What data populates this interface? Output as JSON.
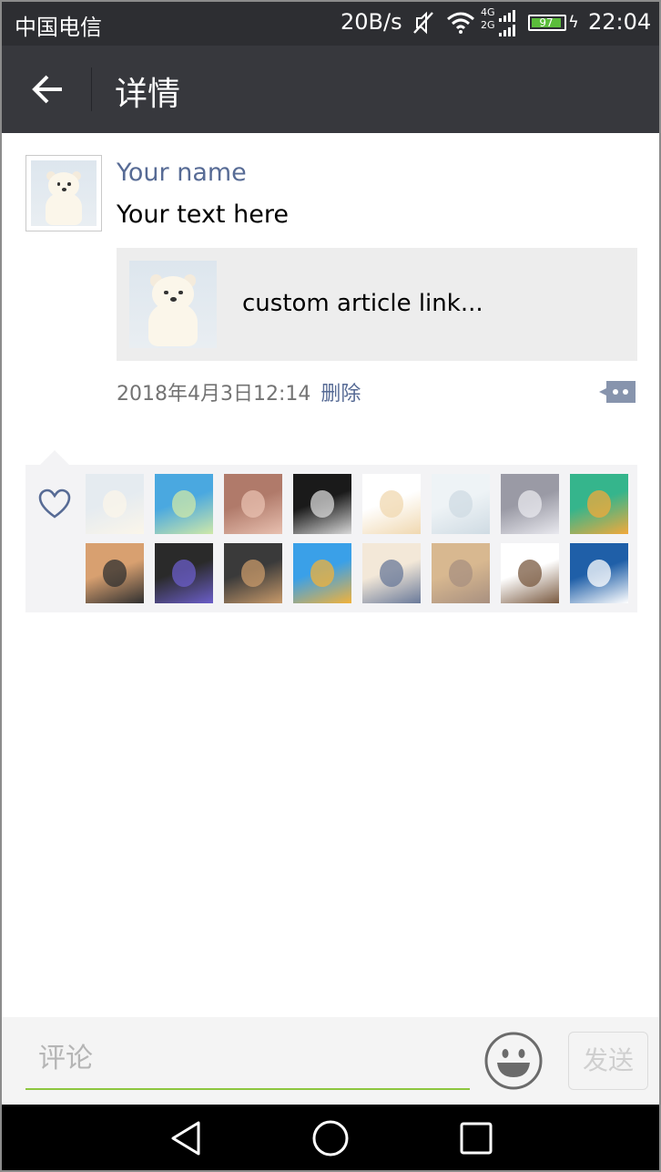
{
  "status_bar": {
    "carrier": "中国电信",
    "speed": "20B/s",
    "network_top": "4G",
    "network_bottom": "2G",
    "battery": "97",
    "time": "22:04"
  },
  "header": {
    "title": "详情"
  },
  "post": {
    "name": "Your name",
    "text": "Your text here",
    "article_title": "custom article link...",
    "date": "2018年4月3日12:14",
    "delete_label": "删除"
  },
  "likes": {
    "avatars": [
      {
        "icon": "bear-avatar",
        "colors": [
          "#e5ebf0",
          "#fbf6ea"
        ]
      },
      {
        "icon": "anime-boy-avatar",
        "colors": [
          "#4aa8e0",
          "#cfe8a8"
        ]
      },
      {
        "icon": "girl-glasses-avatar",
        "colors": [
          "#b07a6a",
          "#e8c0b0"
        ]
      },
      {
        "icon": "dark-face-avatar",
        "colors": [
          "#1a1a1a",
          "#d8d8d8"
        ]
      },
      {
        "icon": "cartoon-cat-avatar",
        "colors": [
          "#ffffff",
          "#f0d8b0"
        ]
      },
      {
        "icon": "mountain-placeholder-avatar",
        "colors": [
          "#eef3f6",
          "#cfdbe3"
        ]
      },
      {
        "icon": "sleeping-cat-avatar",
        "colors": [
          "#9a9aa5",
          "#e8e8ee"
        ]
      },
      {
        "icon": "daima-app-avatar",
        "colors": [
          "#35b58c",
          "#f2a93b"
        ]
      },
      {
        "icon": "camera-girl-avatar",
        "colors": [
          "#d8a070",
          "#303030"
        ]
      },
      {
        "icon": "app-grid-avatar",
        "colors": [
          "#2a2a2a",
          "#6b5ec9"
        ]
      },
      {
        "icon": "dog-avatar",
        "colors": [
          "#3a3a3a",
          "#c89a6a"
        ]
      },
      {
        "icon": "headphone-girl-avatar",
        "colors": [
          "#3aa0e8",
          "#f2b23a"
        ]
      },
      {
        "icon": "bunny-girl-avatar",
        "colors": [
          "#f3e8d8",
          "#6a7a9a"
        ]
      },
      {
        "icon": "blurred-avatar",
        "colors": [
          "#d8b890",
          "#a89080"
        ]
      },
      {
        "icon": "cute-bear-avatar",
        "colors": [
          "#ffffff",
          "#7a5a40"
        ]
      },
      {
        "icon": "logo-letters-avatar",
        "colors": [
          "#1f5fa8",
          "#ffffff"
        ]
      }
    ]
  },
  "input": {
    "placeholder": "评论",
    "send_label": "发送"
  },
  "colors": {
    "link_blue": "#576b95",
    "header_bg": "#37383d",
    "status_bg": "#2d2e32",
    "accent_green": "#8dc63f"
  }
}
